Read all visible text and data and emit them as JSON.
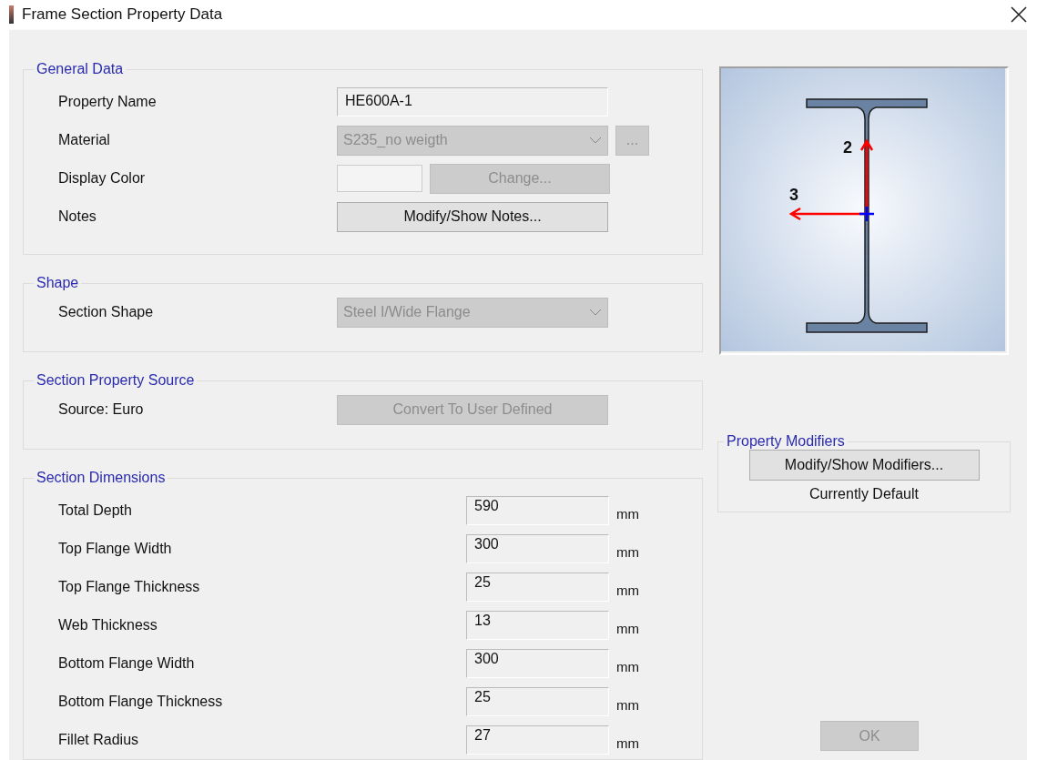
{
  "window": {
    "title": "Frame Section Property Data"
  },
  "general_data": {
    "title": "General Data",
    "rows": [
      {
        "kind": "text",
        "label": "Property Name",
        "value": "HE600A-1",
        "disabled": false
      },
      {
        "kind": "combo",
        "label": "Material",
        "value": "S235_no weigth",
        "disabled": true,
        "extra_button": "...",
        "extra_disabled": true
      },
      {
        "kind": "color",
        "label": "Display Color",
        "button": "Change...",
        "disabled": true
      },
      {
        "kind": "button",
        "label": "Notes",
        "button": "Modify/Show Notes...",
        "disabled": false
      }
    ]
  },
  "shape": {
    "title": "Shape",
    "label": "Section Shape",
    "value": "Steel I/Wide Flange",
    "disabled": true
  },
  "source": {
    "title": "Section Property Source",
    "label": "Source:  Euro",
    "button": "Convert To User Defined",
    "disabled": true
  },
  "dimensions": {
    "title": "Section Dimensions",
    "rows": [
      {
        "label": "Total Depth",
        "value": "590",
        "unit": "mm"
      },
      {
        "label": "Top Flange Width",
        "value": "300",
        "unit": "mm"
      },
      {
        "label": "Top Flange Thickness",
        "value": "25",
        "unit": "mm"
      },
      {
        "label": "Web Thickness",
        "value": "13",
        "unit": "mm"
      },
      {
        "label": "Bottom Flange Width",
        "value": "300",
        "unit": "mm"
      },
      {
        "label": "Bottom Flange Thickness",
        "value": "25",
        "unit": "mm"
      },
      {
        "label": "Fillet Radius",
        "value": "27",
        "unit": "mm"
      }
    ]
  },
  "preview": {
    "axis_2": "2",
    "axis_3": "3"
  },
  "modifiers": {
    "title": "Property Modifiers",
    "button": "Modify/Show Modifiers...",
    "status": "Currently Default"
  },
  "ok_button": {
    "label": "OK",
    "disabled": true
  }
}
